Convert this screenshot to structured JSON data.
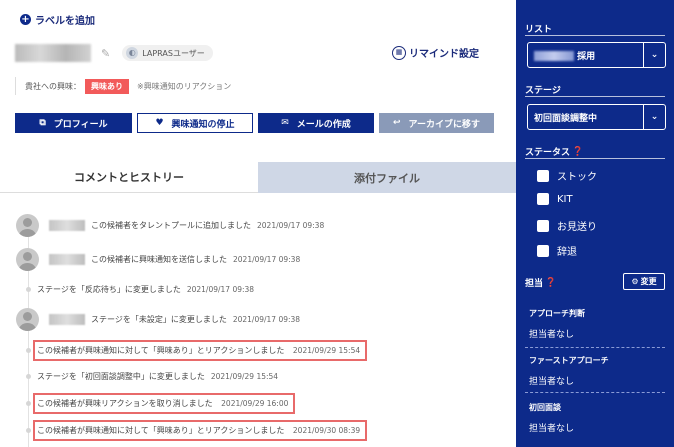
{
  "header": {
    "add_label": "ラベルを追加",
    "badge": "LAPRASユーザー",
    "remind": "リマインド設定",
    "interest_label": "貴社への興味：",
    "interest_badge": "興味あり",
    "interest_note": "※興味通知のリアクション"
  },
  "buttons": {
    "profile": "プロフィール",
    "stop": "興味通知の停止",
    "mail": "メールの作成",
    "archive": "アーカイブに移す"
  },
  "tabs": {
    "history": "コメントとヒストリー",
    "files": "添付ファイル"
  },
  "timeline": [
    {
      "text": "この候補者をタレントプールに追加しました",
      "time": "2021/09/17 09:38"
    },
    {
      "text": "この候補者に興味通知を送信しました",
      "time": "2021/09/17 09:38"
    },
    {
      "text": "ステージを「反応待ち」に変更しました",
      "time": "2021/09/17 09:38"
    },
    {
      "text": "ステージを「未設定」に変更しました",
      "time": "2021/09/17 09:38"
    },
    {
      "text": "この候補者が興味通知に対して「興味あり」とリアクションしました",
      "time": "2021/09/29 15:54"
    },
    {
      "text": "ステージを「初回面談調整中」に変更しました",
      "time": "2021/09/29 15:54"
    },
    {
      "text": "この候補者が興味リアクションを取り消しました",
      "time": "2021/09/29 16:00"
    },
    {
      "text": "この候補者が興味通知に対して「興味あり」とリアクションしました",
      "time": "2021/09/30 08:39"
    }
  ],
  "sidebar": {
    "list_label": "リスト",
    "list_value_suffix": "採用",
    "stage_label": "ステージ",
    "stage_value": "初回面談調整中",
    "status_label": "ステータス",
    "statuses": [
      "ストック",
      "KIT",
      "お見送り",
      "辞退"
    ],
    "owner_label": "担当",
    "change_button": "変更",
    "assignees": [
      {
        "title": "アプローチ判断",
        "value": "担当者なし"
      },
      {
        "title": "ファーストアプローチ",
        "value": "担当者なし"
      },
      {
        "title": "初回面談",
        "value": "担当者なし"
      }
    ]
  }
}
